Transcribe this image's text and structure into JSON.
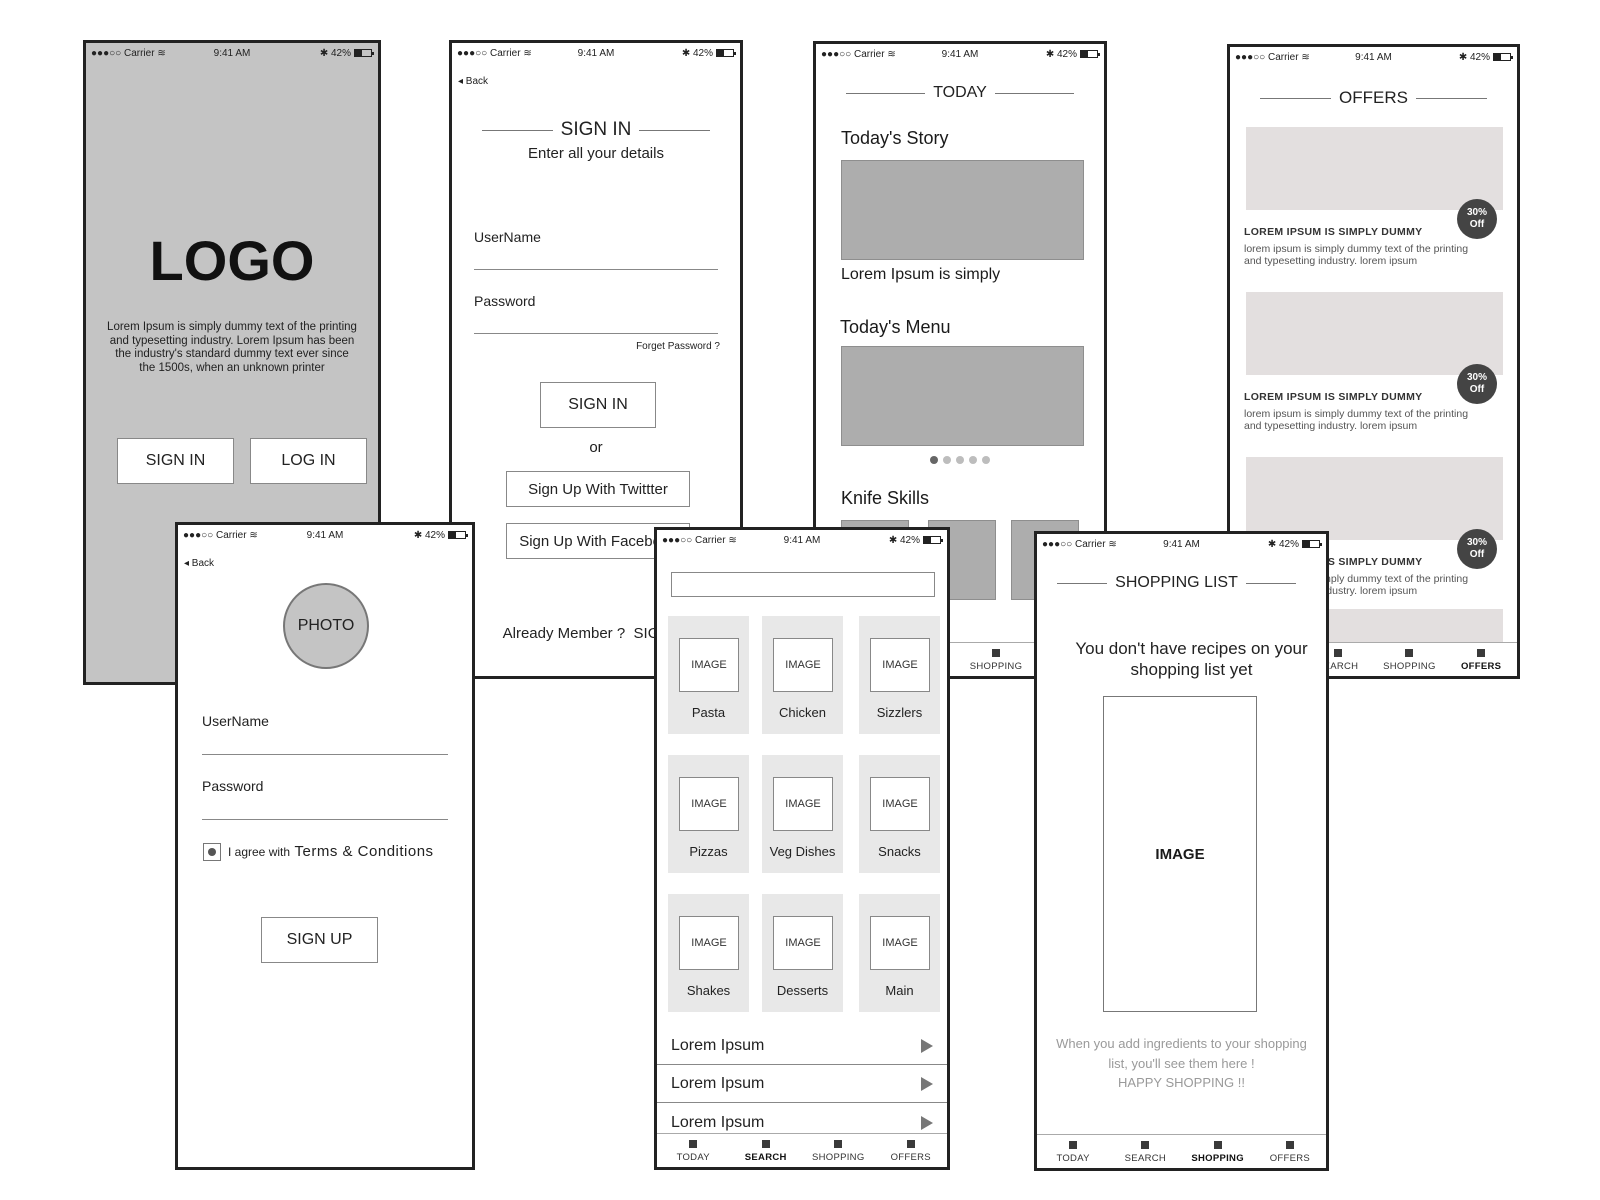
{
  "status_bar": {
    "carrier": "●●●○○ Carrier",
    "wifi_icon": "wifi-icon",
    "time": "9:41 AM",
    "bluetooth_icon": "bluetooth-icon",
    "battery": "42%"
  },
  "splash": {
    "logo": "LOGO",
    "description": "Lorem Ipsum is simply dummy text of the printing and typesetting industry. Lorem Ipsum has been the industry's standard dummy text ever since the 1500s, when an unknown printer",
    "sign_in_label": "SIGN IN",
    "log_in_label": "LOG IN"
  },
  "sign_in": {
    "back_label": "◂ Back",
    "title": "SIGN IN",
    "subtitle": "Enter all your details",
    "username_label": "UserName",
    "password_label": "Password",
    "forgot_password": "Forget Password ?",
    "sign_in_button": "SIGN IN",
    "or_label": "or",
    "twitter_button": "Sign Up With Twittter",
    "facebook_button": "Sign Up With Facebook",
    "already_member": "Already Member ?",
    "sign_in_link": "SIGN IN"
  },
  "sign_up": {
    "back_label": "◂ Back",
    "photo_label": "PHOTO",
    "username_label": "UserName",
    "password_label": "Password",
    "agree_prefix": "I agree with",
    "terms_link": "Terms & Conditions",
    "agree_checked": true,
    "sign_up_button": "SIGN UP"
  },
  "today": {
    "title": "TODAY",
    "story_heading": "Today's Story",
    "story_caption": "Lorem Ipsum is simply",
    "menu_heading": "Today's Menu",
    "carousel_pages": 5,
    "carousel_active": 1,
    "knife_heading": "Knife Skills",
    "next_icon": "play-arrow-icon"
  },
  "offers": {
    "title": "OFFERS",
    "items": [
      {
        "badge": "30% Off",
        "title": "LOREM IPSUM IS SIMPLY DUMMY",
        "desc": "lorem ipsum is simply dummy text of the printing and typesetting industry. lorem ipsum"
      },
      {
        "badge": "30% Off",
        "title": "LOREM IPSUM IS SIMPLY DUMMY",
        "desc": "lorem ipsum is simply dummy text of the printing and typesetting industry. lorem ipsum"
      },
      {
        "badge": "30% Off",
        "title": "LOREM IPSUM IS SIMPLY DUMMY",
        "desc": "lorem ipsum is simply dummy text of the printing and typesetting industry. lorem ipsum"
      }
    ]
  },
  "search": {
    "search_placeholder": "",
    "image_label": "IMAGE",
    "categories": [
      "Pasta",
      "Chicken",
      "Sizzlers",
      "Pizzas",
      "Veg Dishes",
      "Snacks",
      "Shakes",
      "Desserts",
      "Main"
    ],
    "list": [
      "Lorem Ipsum",
      "Lorem Ipsum",
      "Lorem Ipsum"
    ]
  },
  "shopping": {
    "title": "SHOPPING LIST",
    "empty_heading": "You don't have recipes on your shopping list yet",
    "image_label": "IMAGE",
    "hint_line1": "When you add ingredients to your shopping list, you'll see them here !",
    "hint_line2": "HAPPY SHOPPING !!"
  },
  "tabs": [
    "TODAY",
    "SEARCH",
    "SHOPPING",
    "OFFERS"
  ],
  "colors": {
    "splash_bg": "#c4c4c4",
    "placeholder_gray": "#adadad",
    "offer_image": "#e3dfdf",
    "badge": "#444444",
    "category_tile": "#e8e8e8"
  }
}
